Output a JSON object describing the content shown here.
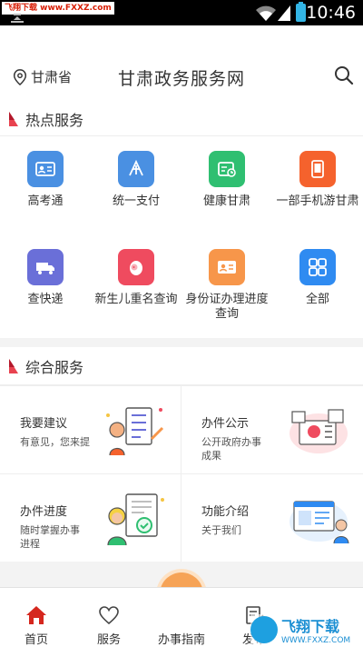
{
  "status_bar": {
    "watermark": "飞翔下载 www.FXXZ.com",
    "time": "10:46"
  },
  "header": {
    "location": "甘肃省",
    "title": "甘肃政务服务网"
  },
  "hot_services": {
    "title": "热点服务",
    "items": [
      {
        "label": "高考通",
        "color": "#4a90e2",
        "icon": "id-card-icon"
      },
      {
        "label": "统一支付",
        "color": "#4a90e2",
        "icon": "payment-icon"
      },
      {
        "label": "健康甘肃",
        "color": "#2fbf71",
        "icon": "health-icon"
      },
      {
        "label": "一部手机游甘肃",
        "color": "#f5622d",
        "icon": "phone-icon"
      },
      {
        "label": "查快递",
        "color": "#6a6fd8",
        "icon": "truck-icon"
      },
      {
        "label": "新生儿重名查询",
        "color": "#ef4b5f",
        "icon": "baby-icon"
      },
      {
        "label": "身份证办理进度查询",
        "color": "#f7964a",
        "icon": "id-card-icon"
      },
      {
        "label": "全部",
        "color": "#2f8bf1",
        "icon": "grid-icon"
      }
    ]
  },
  "composite_services": {
    "title": "综合服务",
    "items": [
      {
        "title": "我要建议",
        "subtitle": "有意见，您来提",
        "icon": "suggestion-illustration"
      },
      {
        "title": "办件公示",
        "subtitle": "公开政府办事成果",
        "icon": "public-illustration"
      },
      {
        "title": "办件进度",
        "subtitle": "随时掌握办事进程",
        "icon": "progress-illustration"
      },
      {
        "title": "功能介绍",
        "subtitle": "关于我们",
        "icon": "intro-illustration"
      }
    ]
  },
  "bottom_nav": {
    "items": [
      {
        "label": "首页",
        "icon": "home-icon",
        "active": true
      },
      {
        "label": "服务",
        "icon": "heart-icon",
        "active": false
      },
      {
        "label": "办事指南",
        "icon": "guide-icon",
        "active": false
      },
      {
        "label": "发布",
        "icon": "edit-icon",
        "active": false
      }
    ],
    "active_color": "#d5271e"
  },
  "brand_watermark": {
    "name": "飞翔下载",
    "url": "WWW.FXXZ.COM"
  }
}
